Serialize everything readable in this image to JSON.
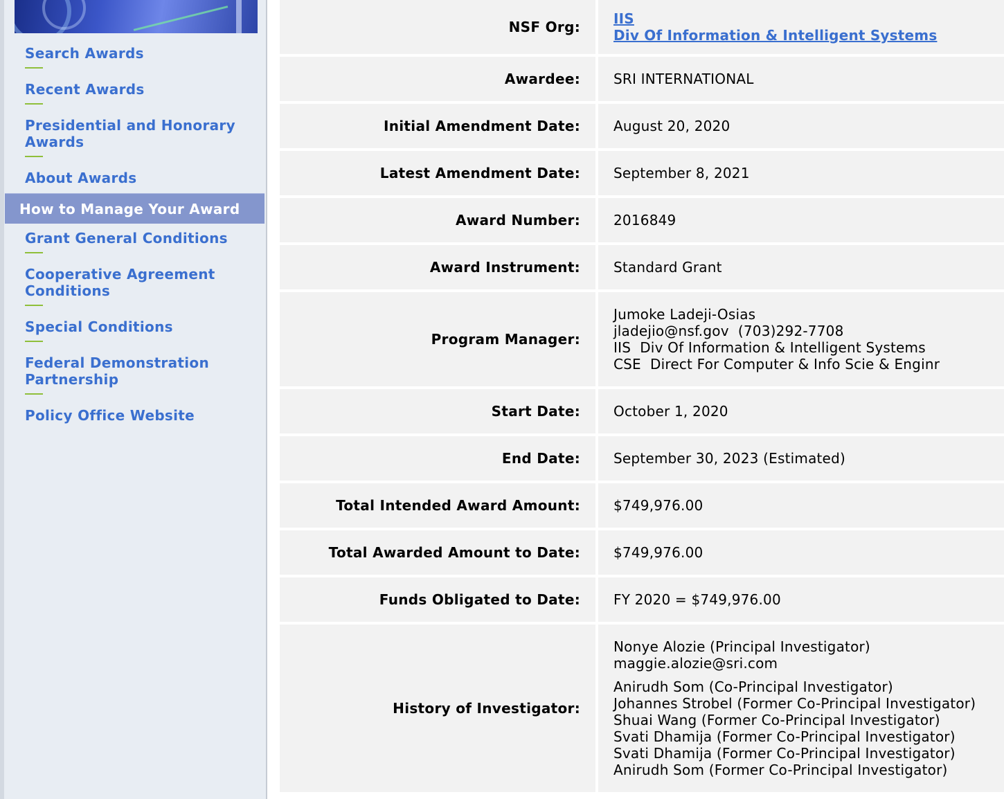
{
  "sidebar": {
    "items": [
      {
        "label": "Search Awards"
      },
      {
        "label": "Recent Awards"
      },
      {
        "label": "Presidential and Honorary Awards"
      },
      {
        "label": "About Awards"
      },
      {
        "label": "How to Manage Your Award"
      },
      {
        "label": "Grant General Conditions"
      },
      {
        "label": "Cooperative Agreement Conditions"
      },
      {
        "label": "Special Conditions"
      },
      {
        "label": "Federal Demonstration Partnership"
      },
      {
        "label": "Policy Office Website"
      }
    ],
    "active_index": 4
  },
  "award": {
    "nsf_org": {
      "label": "NSF Org:",
      "code": "IIS",
      "name": "Div Of Information & Intelligent Systems"
    },
    "awardee": {
      "label": "Awardee:",
      "value": "SRI INTERNATIONAL"
    },
    "initial_amendment_date": {
      "label": "Initial Amendment Date:",
      "value": "August 20, 2020"
    },
    "latest_amendment_date": {
      "label": "Latest Amendment Date:",
      "value": "September 8, 2021"
    },
    "award_number": {
      "label": "Award Number:",
      "value": "2016849"
    },
    "award_instrument": {
      "label": "Award Instrument:",
      "value": "Standard Grant"
    },
    "program_manager": {
      "label": "Program Manager:",
      "name": "Jumoke Ladeji-Osias",
      "contact": "jladejio@nsf.gov  (703)292-7708",
      "division": "IIS  Div Of Information & Intelligent Systems",
      "directorate": "CSE  Direct For Computer & Info Scie & Enginr"
    },
    "start_date": {
      "label": "Start Date:",
      "value": "October 1, 2020"
    },
    "end_date": {
      "label": "End Date:",
      "value": "September 30, 2023 (Estimated)"
    },
    "total_intended_amount": {
      "label": "Total Intended Award Amount:",
      "value": "$749,976.00"
    },
    "total_awarded_amount": {
      "label": "Total Awarded Amount to Date:",
      "value": "$749,976.00"
    },
    "funds_obligated": {
      "label": "Funds Obligated to Date:",
      "value": "FY 2020 = $749,976.00"
    },
    "history_of_investigator": {
      "label": "History of Investigator:",
      "pi": "Nonye Alozie (Principal Investigator)",
      "pi_email": "maggie.alozie@sri.com",
      "others": [
        "Anirudh Som (Co-Principal Investigator)",
        "Johannes Strobel (Former Co-Principal Investigator)",
        "Shuai Wang (Former Co-Principal Investigator)",
        "Svati Dhamija (Former Co-Principal Investigator)",
        "Svati Dhamija (Former Co-Principal Investigator)",
        "Anirudh Som (Former Co-Principal Investigator)"
      ]
    }
  }
}
